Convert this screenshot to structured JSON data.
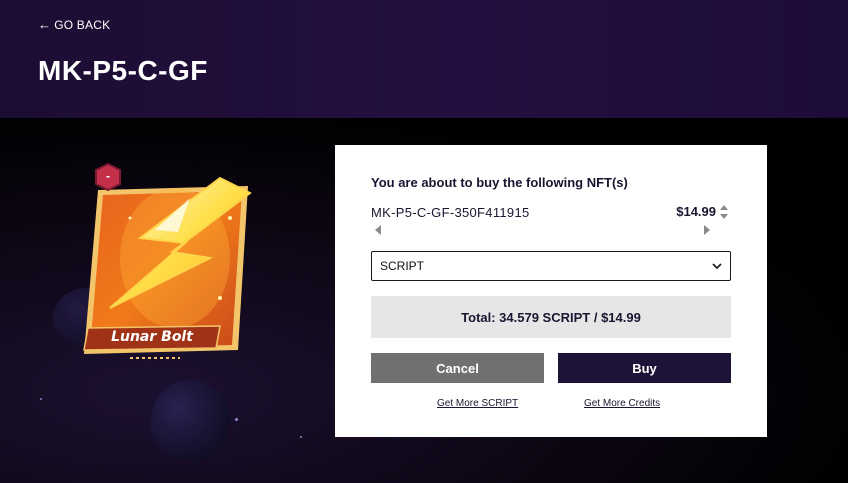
{
  "header": {
    "back_label": "GO BACK",
    "title": "MK-P5-C-GF"
  },
  "card": {
    "name": "Lunar Bolt",
    "badge": "-"
  },
  "purchase": {
    "heading": "You are about to buy the following NFT(s)",
    "nft_id": "MK-P5-C-GF-350F411915",
    "price": "$14.99",
    "currency_selected": "SCRIPT",
    "total": "Total: 34.579 SCRIPT / $14.99",
    "cancel_label": "Cancel",
    "buy_label": "Buy",
    "link_script": "Get More SCRIPT",
    "link_credits": "Get More Credits"
  },
  "colors": {
    "header_bg": "#241040",
    "buy_button": "#1e1238",
    "cancel_button": "#707070",
    "total_bg": "#e6e6e6"
  }
}
